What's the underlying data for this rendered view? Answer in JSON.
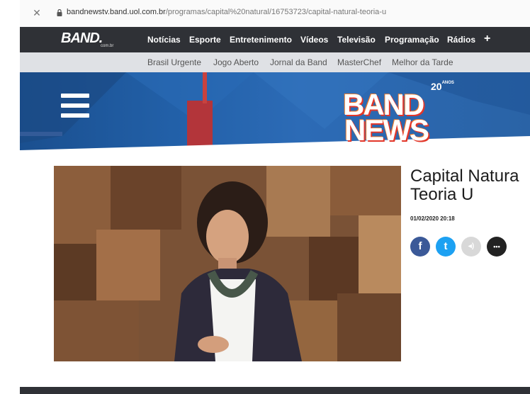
{
  "browser": {
    "url_host": "bandnewstv.band.uol.com.br",
    "url_path": "/programas/capital%20natural/16753723/capital-natural-teoria-u"
  },
  "topnav": {
    "logo": "BAND.",
    "logo_sub": "com.br",
    "items": [
      "Notícias",
      "Esporte",
      "Entretenimento",
      "Vídeos",
      "Televisão",
      "Programação",
      "Rádios"
    ],
    "plus": "+"
  },
  "subnav": {
    "items": [
      "Brasil Urgente",
      "Jogo Aberto",
      "Jornal da Band",
      "MasterChef",
      "Melhor da Tarde"
    ]
  },
  "hero": {
    "badge_number": "20",
    "badge_word": "ANOS",
    "logo_line1": "BAND",
    "logo_line2": "NEWS"
  },
  "article": {
    "title_line1": "Capital Natura",
    "title_line2": "Teoria U",
    "date": "01/02/2020 20:18"
  },
  "share": [
    {
      "icon": "facebook-icon",
      "glyph": "f",
      "color": "#3b5998"
    },
    {
      "icon": "twitter-icon",
      "glyph": "t",
      "color": "#1da1f2"
    },
    {
      "icon": "sound-icon",
      "glyph": "◂)",
      "color": "#d8d8d8"
    },
    {
      "icon": "more-icon",
      "glyph": "•••",
      "color": "#222222"
    }
  ],
  "colors": {
    "nav_bg": "#2f3136",
    "subnav_bg": "#dfe1e5",
    "hero_blue": "#2260a8",
    "accent_red": "#e2372a"
  }
}
